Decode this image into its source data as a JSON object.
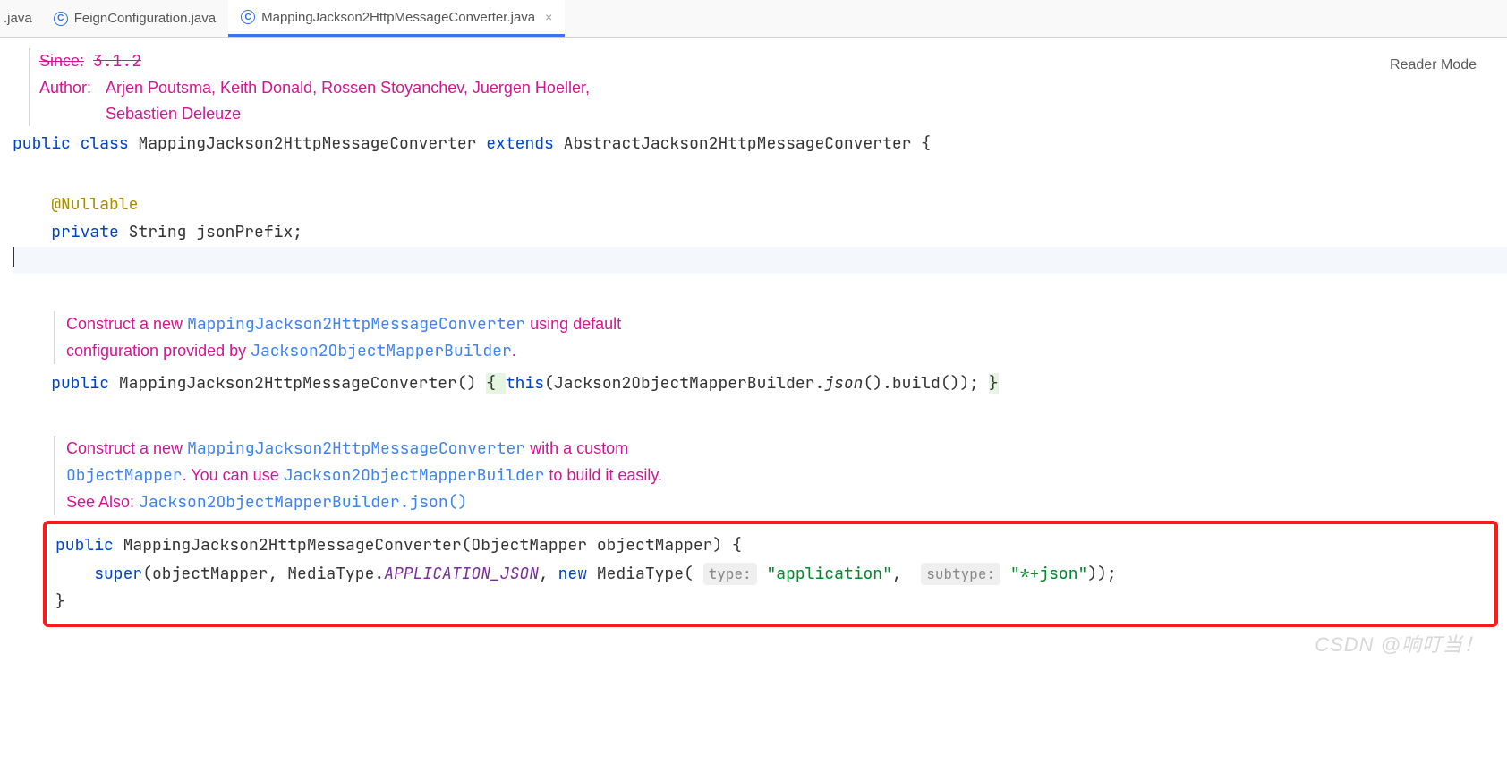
{
  "tabs": {
    "partial": ".java",
    "feign": "FeignConfiguration.java",
    "active": "MappingJackson2HttpMessageConverter.java",
    "close_glyph": "×"
  },
  "header": {
    "reader_mode": "Reader Mode"
  },
  "docTop": {
    "since_label": "Since:",
    "since_val": "3.1.2",
    "author_label": "Author:",
    "authors_line1": "Arjen Poutsma, Keith Donald, Rossen Stoyanchev, Juergen Hoeller,",
    "authors_line2": "Sebastien Deleuze"
  },
  "classDecl": {
    "kw_public": "public",
    "kw_class": "class",
    "name": "MappingJackson2HttpMessageConverter",
    "kw_extends": "extends",
    "super": "AbstractJackson2HttpMessageConverter",
    "brace": "{"
  },
  "field": {
    "ann": "@Nullable",
    "kw_private": "private",
    "type": "String",
    "name": "jsonPrefix",
    "semi": ";"
  },
  "doc1": {
    "l1a": "Construct a new ",
    "l1b": "MappingJackson2HttpMessageConverter",
    "l1c": " using default",
    "l2a": "configuration provided by ",
    "l2b": "Jackson2ObjectMapperBuilder",
    "l2c": "."
  },
  "ctor1": {
    "kw_public": "public",
    "name": "MappingJackson2HttpMessageConverter",
    "empty": "() ",
    "ob": "{ ",
    "this": "this",
    "call": "(Jackson2ObjectMapperBuilder.",
    "json": "json",
    "tail": "().build()); ",
    "cb": "}"
  },
  "doc2": {
    "l1a": "Construct a new ",
    "l1b": "MappingJackson2HttpMessageConverter",
    "l1c": " with a custom",
    "l2a": "ObjectMapper",
    "l2b": ". You can use ",
    "l2c": "Jackson2ObjectMapperBuilder",
    "l2d": " to build it easily.",
    "see_label": "See Also: ",
    "see_val": "Jackson2ObjectMapperBuilder.json()"
  },
  "ctor2": {
    "kw_public": "public",
    "name": "MappingJackson2HttpMessageConverter",
    "params": "(ObjectMapper objectMapper) {",
    "super": "super",
    "open": "(objectMapper, MediaType.",
    "const": "APPLICATION_JSON",
    "sep": ", ",
    "new": "new",
    "mt": " MediaType( ",
    "hint1": "type:",
    "str1": "\"application\"",
    "sep2": ",  ",
    "hint2": "subtype:",
    "str2": "\"*+json\"",
    "tail": "));",
    "cb": "}"
  },
  "watermark": "CSDN @响叮当！"
}
